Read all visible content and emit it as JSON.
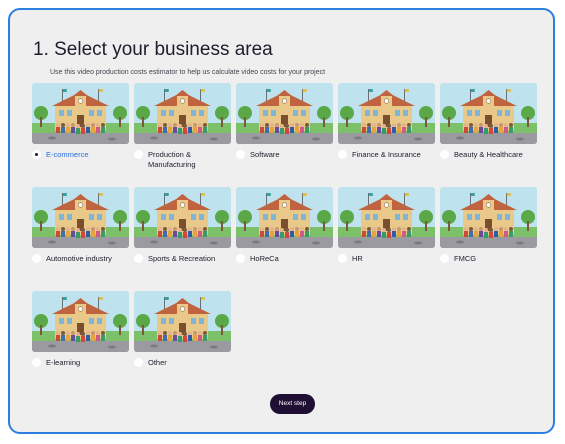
{
  "page": {
    "title": "1. Select your business area",
    "subtitle": "Use this video production costs estimator to help us calculate video costs for your project"
  },
  "options": [
    {
      "label": "E-commerce",
      "selected": true
    },
    {
      "label": "Production & Manufacturing",
      "selected": false
    },
    {
      "label": "Software",
      "selected": false
    },
    {
      "label": "Finance & Insurance",
      "selected": false
    },
    {
      "label": "Beauty & Healthcare",
      "selected": false
    },
    {
      "label": "Automotive industry",
      "selected": false
    },
    {
      "label": "Sports & Recreation",
      "selected": false
    },
    {
      "label": "HoReCa",
      "selected": false
    },
    {
      "label": "HR",
      "selected": false
    },
    {
      "label": "FMCG",
      "selected": false
    },
    {
      "label": "E-learning",
      "selected": false
    },
    {
      "label": "Other",
      "selected": false
    }
  ],
  "next_button": {
    "label": "Next step"
  },
  "colors": {
    "border": "#2b7fe0",
    "card_bg": "#efeff0",
    "selected_text": "#2b6fd6",
    "button_bg": "#1e0f33"
  }
}
